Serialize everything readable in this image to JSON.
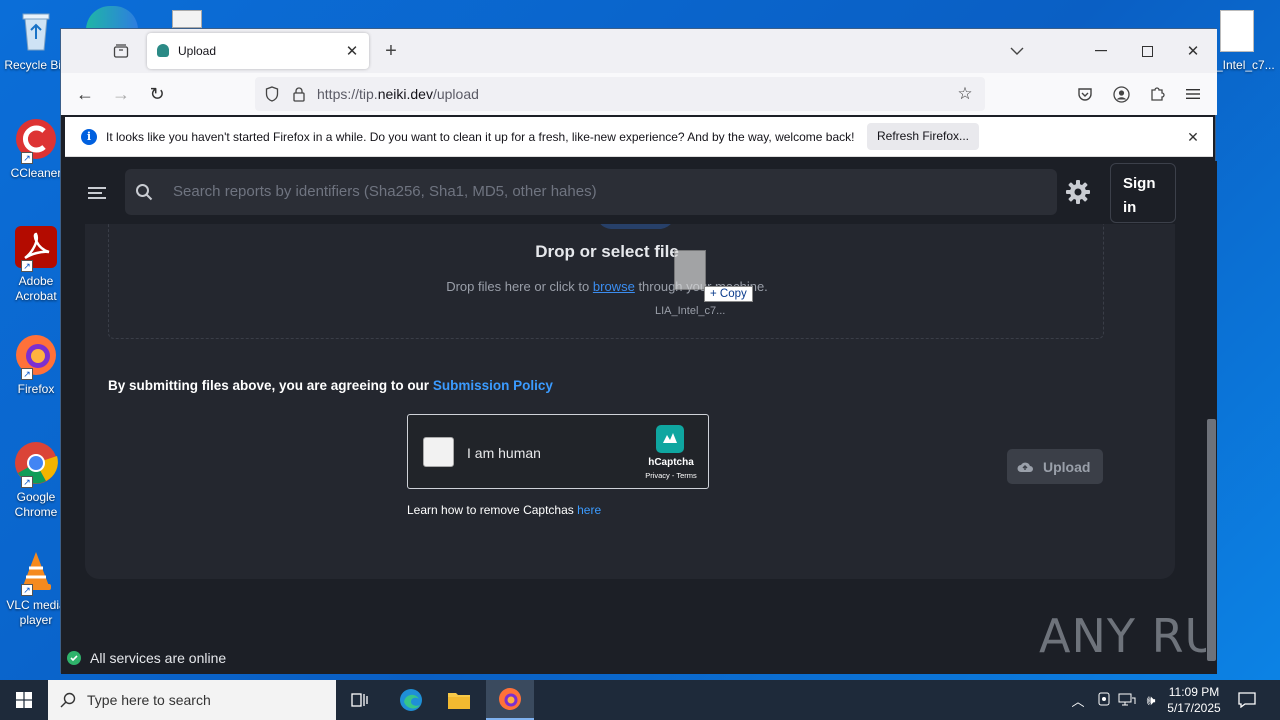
{
  "desktop": {
    "icons": [
      {
        "label": "Recycle Bin"
      },
      {
        "label": "CCleaner"
      },
      {
        "label": "Adobe Acrobat"
      },
      {
        "label": "Firefox"
      },
      {
        "label": "Google Chrome"
      },
      {
        "label": "VLC media player"
      }
    ],
    "right_file_label": "_Intel_c7..."
  },
  "browser": {
    "tab_title": "Upload",
    "url_prefix": "https://tip.",
    "url_domain": "neiki.dev",
    "url_path": "/upload",
    "notification": {
      "text": "It looks like you haven't started Firefox in a while. Do you want to clean it up for a fresh, like-new experience? And by the way, welcome back!",
      "button": "Refresh Firefox..."
    }
  },
  "site": {
    "search_placeholder": "Search reports by identifiers (Sha256, Sha1, MD5, other hahes)",
    "sign_in": "Sign in",
    "drop_title": "Drop or select file",
    "drop_text_before": "Drop files here or click to",
    "drop_link": "browse",
    "drop_text_after": "through your machine.",
    "drag_file_label": "LIA_Intel_c7...",
    "drag_copy": "Copy",
    "policy_text": "By submitting files above, you are agreeing to our",
    "policy_link": "Submission Policy",
    "captcha_label": "I am human",
    "captcha_brand": "hCaptcha",
    "captcha_links": "Privacy - Terms",
    "captcha_help": "Learn how to remove Captchas",
    "captcha_help_link": "here",
    "upload_button": "Upload",
    "status_text": "All services are online",
    "watermark": "ANY RUN"
  },
  "taskbar": {
    "search_placeholder": "Type here to search",
    "time": "11:09 PM",
    "date": "5/17/2025"
  },
  "colors": {
    "accent": "#1e90ff",
    "status_green": "#2fb36b",
    "page_bg": "#1c1f26",
    "card_bg": "#24272f"
  }
}
